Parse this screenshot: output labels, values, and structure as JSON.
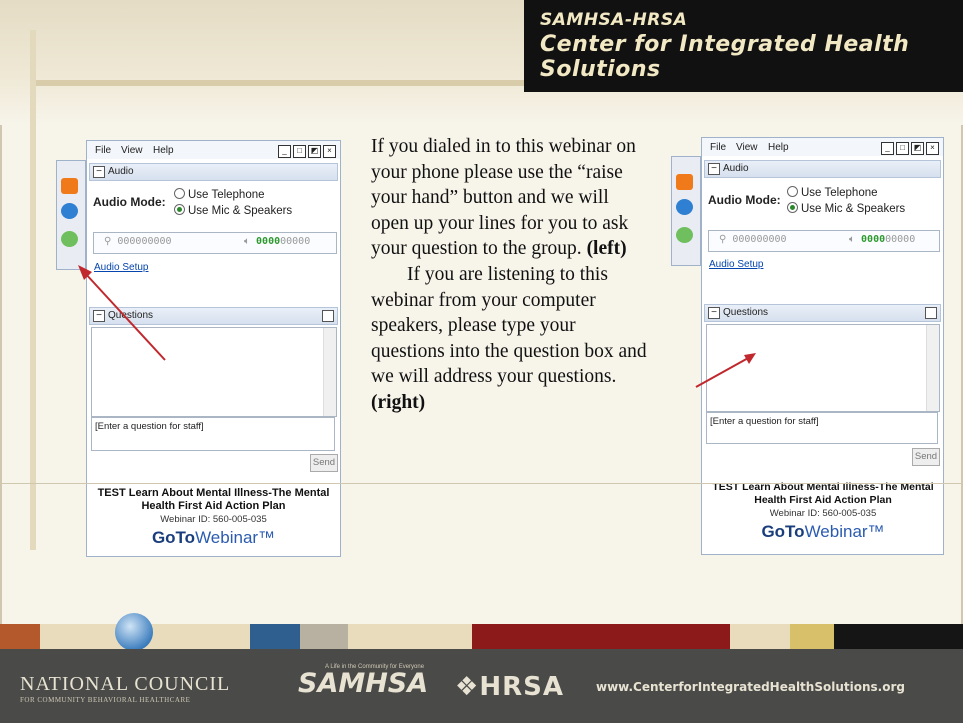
{
  "header": {
    "line1": "SAMHSA-HRSA",
    "line2": "Center for Integrated Health Solutions"
  },
  "body": {
    "para1_pre": "If you dialed in to this webinar on your phone please use the “raise your hand” button and we will open up your lines for you to ask your question to the group. ",
    "para1_bold": "(left)",
    "para2_pre": "If you are listening to this webinar from your computer speakers, please type your questions into the question box and we will address your questions. ",
    "para2_bold": "(right)"
  },
  "panel": {
    "menu": {
      "file": "File",
      "view": "View",
      "help": "Help"
    },
    "audio_header": "Audio",
    "audio_mode_label": "Audio Mode:",
    "radio_telephone": "Use Telephone",
    "radio_mic": "Use Mic & Speakers",
    "mic_meter": "000000000",
    "spk_meter_on": "0000",
    "spk_meter_off": "00000",
    "audio_setup": "Audio Setup",
    "questions_header": "Questions",
    "question_placeholder": "[Enter a question for staff]",
    "send": "Send",
    "webinar_title": "TEST Learn About Mental Illness-The Mental Health First Aid Action Plan",
    "webinar_id": "Webinar ID: 560-005-035",
    "brand_goto": "GoTo",
    "brand_webinar": "Webinar™"
  },
  "footer": {
    "national_council": "NATIONAL COUNCIL",
    "national_council_sub": "FOR COMMUNITY BEHAVIORAL HEALTHCARE",
    "samhsa": "SAMHSA",
    "samhsa_tag": "A Life in the Community for Everyone",
    "hrsa": "HRSA",
    "url": "www.CenterforIntegratedHealthSolutions.org"
  },
  "colors": {
    "footer_bar": [
      "#b4592c",
      "#e8dcbc",
      "#2f5f8f",
      "#b8b0a0",
      "#e8dcbc",
      "#8c1a1a",
      "#e8dcbc",
      "#d8c06a",
      "#151515"
    ]
  }
}
